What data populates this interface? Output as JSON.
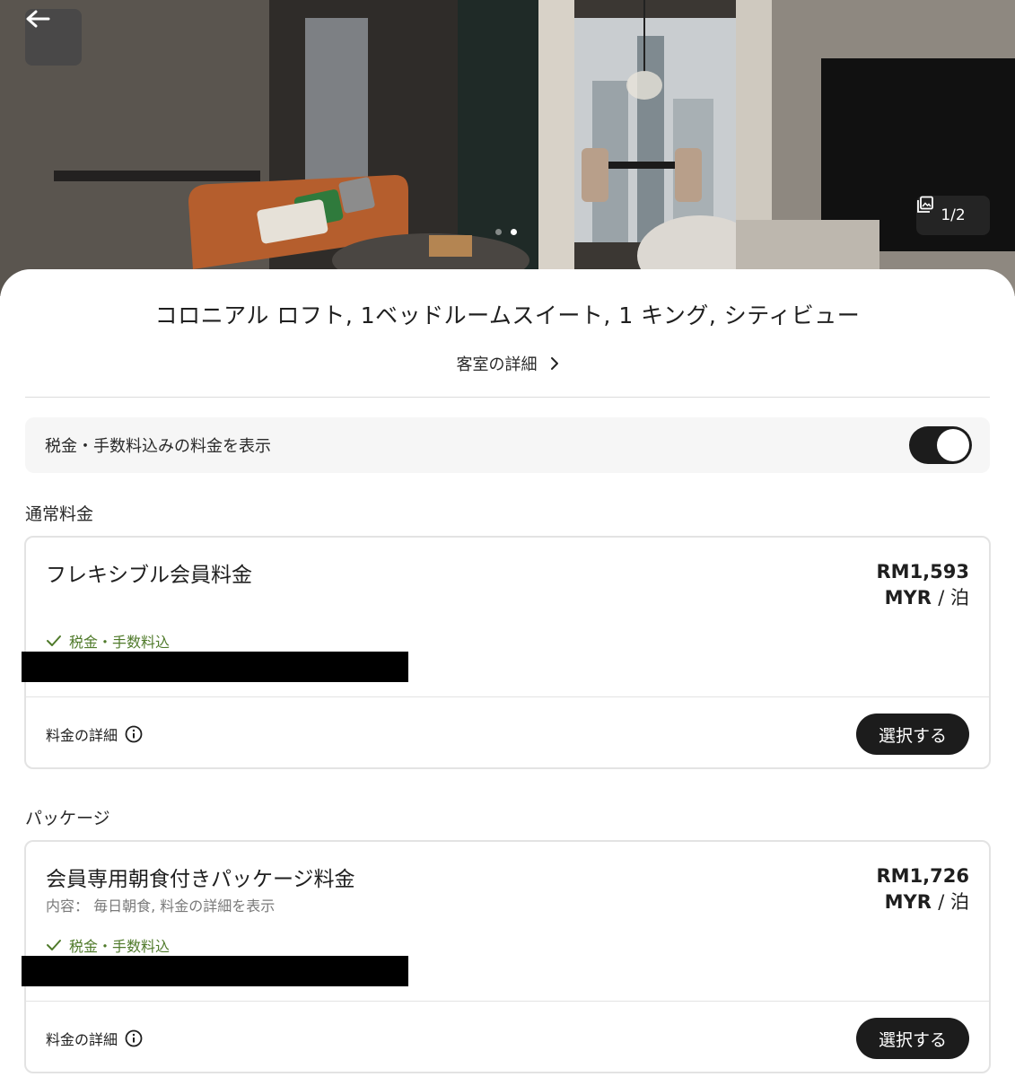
{
  "hero": {
    "image_counter": "1/2",
    "icons": {
      "back": "arrow-left-icon",
      "gallery": "gallery-icon"
    },
    "dots": {
      "count": 2,
      "active_index": 1
    }
  },
  "room": {
    "title": "コロニアル ロフト, 1ベッドルームスイート, 1 キング, シティビュー",
    "details_link": "客室の詳細"
  },
  "tax_toggle": {
    "label": "税金・手数料込みの料金を表示",
    "on": true
  },
  "sections": [
    {
      "heading": "通常料金",
      "rate": {
        "name": "フレキシブル会員料金",
        "subtitle": "",
        "price": "RM1,593",
        "currency": "MYR",
        "per_night": "/ 泊",
        "tax_note": "税金・手数料込",
        "details_label": "料金の詳細",
        "select_label": "選択する"
      }
    },
    {
      "heading": "パッケージ",
      "rate": {
        "name": "会員専用朝食付きパッケージ料金",
        "subtitle": "内容： 毎日朝食, 料金の詳細を表示",
        "price": "RM1,726",
        "currency": "MYR",
        "per_night": "/ 泊",
        "tax_note": "税金・手数料込",
        "details_label": "料金の詳細",
        "select_label": "選択する"
      }
    }
  ],
  "colors": {
    "accent_dark": "#1c1c1c",
    "tax_green": "#4f7a2a",
    "card_border": "#e3e3e3"
  }
}
